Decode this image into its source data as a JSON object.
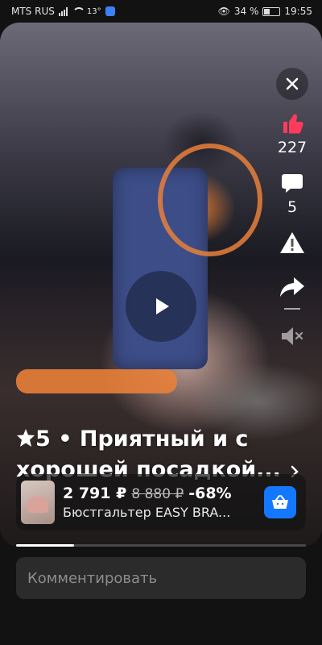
{
  "status": {
    "carrier": "MTS RUS",
    "temp": "13°",
    "battery": "34 %",
    "battery_level": 0.34,
    "time": "19:55"
  },
  "rail": {
    "likes": "227",
    "comments": "5"
  },
  "caption": {
    "rating": "5",
    "text": "• Приятный и с хорошей посадкой..."
  },
  "product": {
    "price": "2 791 ₽",
    "old_price": "8 880 ₽",
    "discount": "-68%",
    "name": "Бюстгальтер EASY BRA..."
  },
  "progress": 0.2,
  "comment": {
    "placeholder": "Комментировать"
  },
  "colors": {
    "accent": "#1478ff",
    "like": "#ff3b5c",
    "scribble": "#e8803a"
  },
  "icons": [
    "close-icon",
    "heart-icon",
    "comment-icon",
    "report-icon",
    "share-icon",
    "mute-icon",
    "play-icon",
    "star-icon",
    "chevron-right-icon",
    "basket-icon"
  ]
}
